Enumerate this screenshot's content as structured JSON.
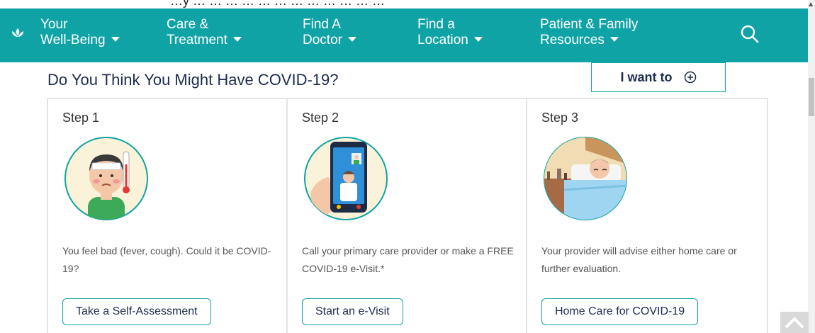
{
  "topstrip": {
    "text": "…y … … … … … … … … … … … …"
  },
  "nav": {
    "items": [
      {
        "line1": "Your",
        "line2": "Well-Being"
      },
      {
        "line1": "Care &",
        "line2": "Treatment"
      },
      {
        "line1": "Find A",
        "line2": "Doctor"
      },
      {
        "line1": "Find a",
        "line2": "Location"
      },
      {
        "line1": "Patient & Family",
        "line2": "Resources"
      }
    ],
    "search_icon": "search-icon",
    "logo_icon": "lotus-logo-icon"
  },
  "main": {
    "heading": "Do You Think You Might Have COVID-19?",
    "i_want_to": "I want to",
    "steps": [
      {
        "step": "Step 1",
        "desc": "You feel bad (fever, cough). Could it be COVID-19?",
        "button": "Take a Self-Assessment",
        "illustration": "sick-person-thermometer"
      },
      {
        "step": "Step 2",
        "desc": "Call your primary care provider or make a FREE COVID-19 e-Visit.*",
        "button": "Start an e-Visit",
        "illustration": "phone-video-call-doctor"
      },
      {
        "step": "Step 3",
        "desc": "Your provider will advise either home care or further evaluation.",
        "button": "Home Care for COVID-19",
        "illustration": "person-resting-in-bed"
      }
    ]
  },
  "colors": {
    "teal": "#10a3a6",
    "navy": "#1d2b4f",
    "border": "#e4e4e4"
  }
}
